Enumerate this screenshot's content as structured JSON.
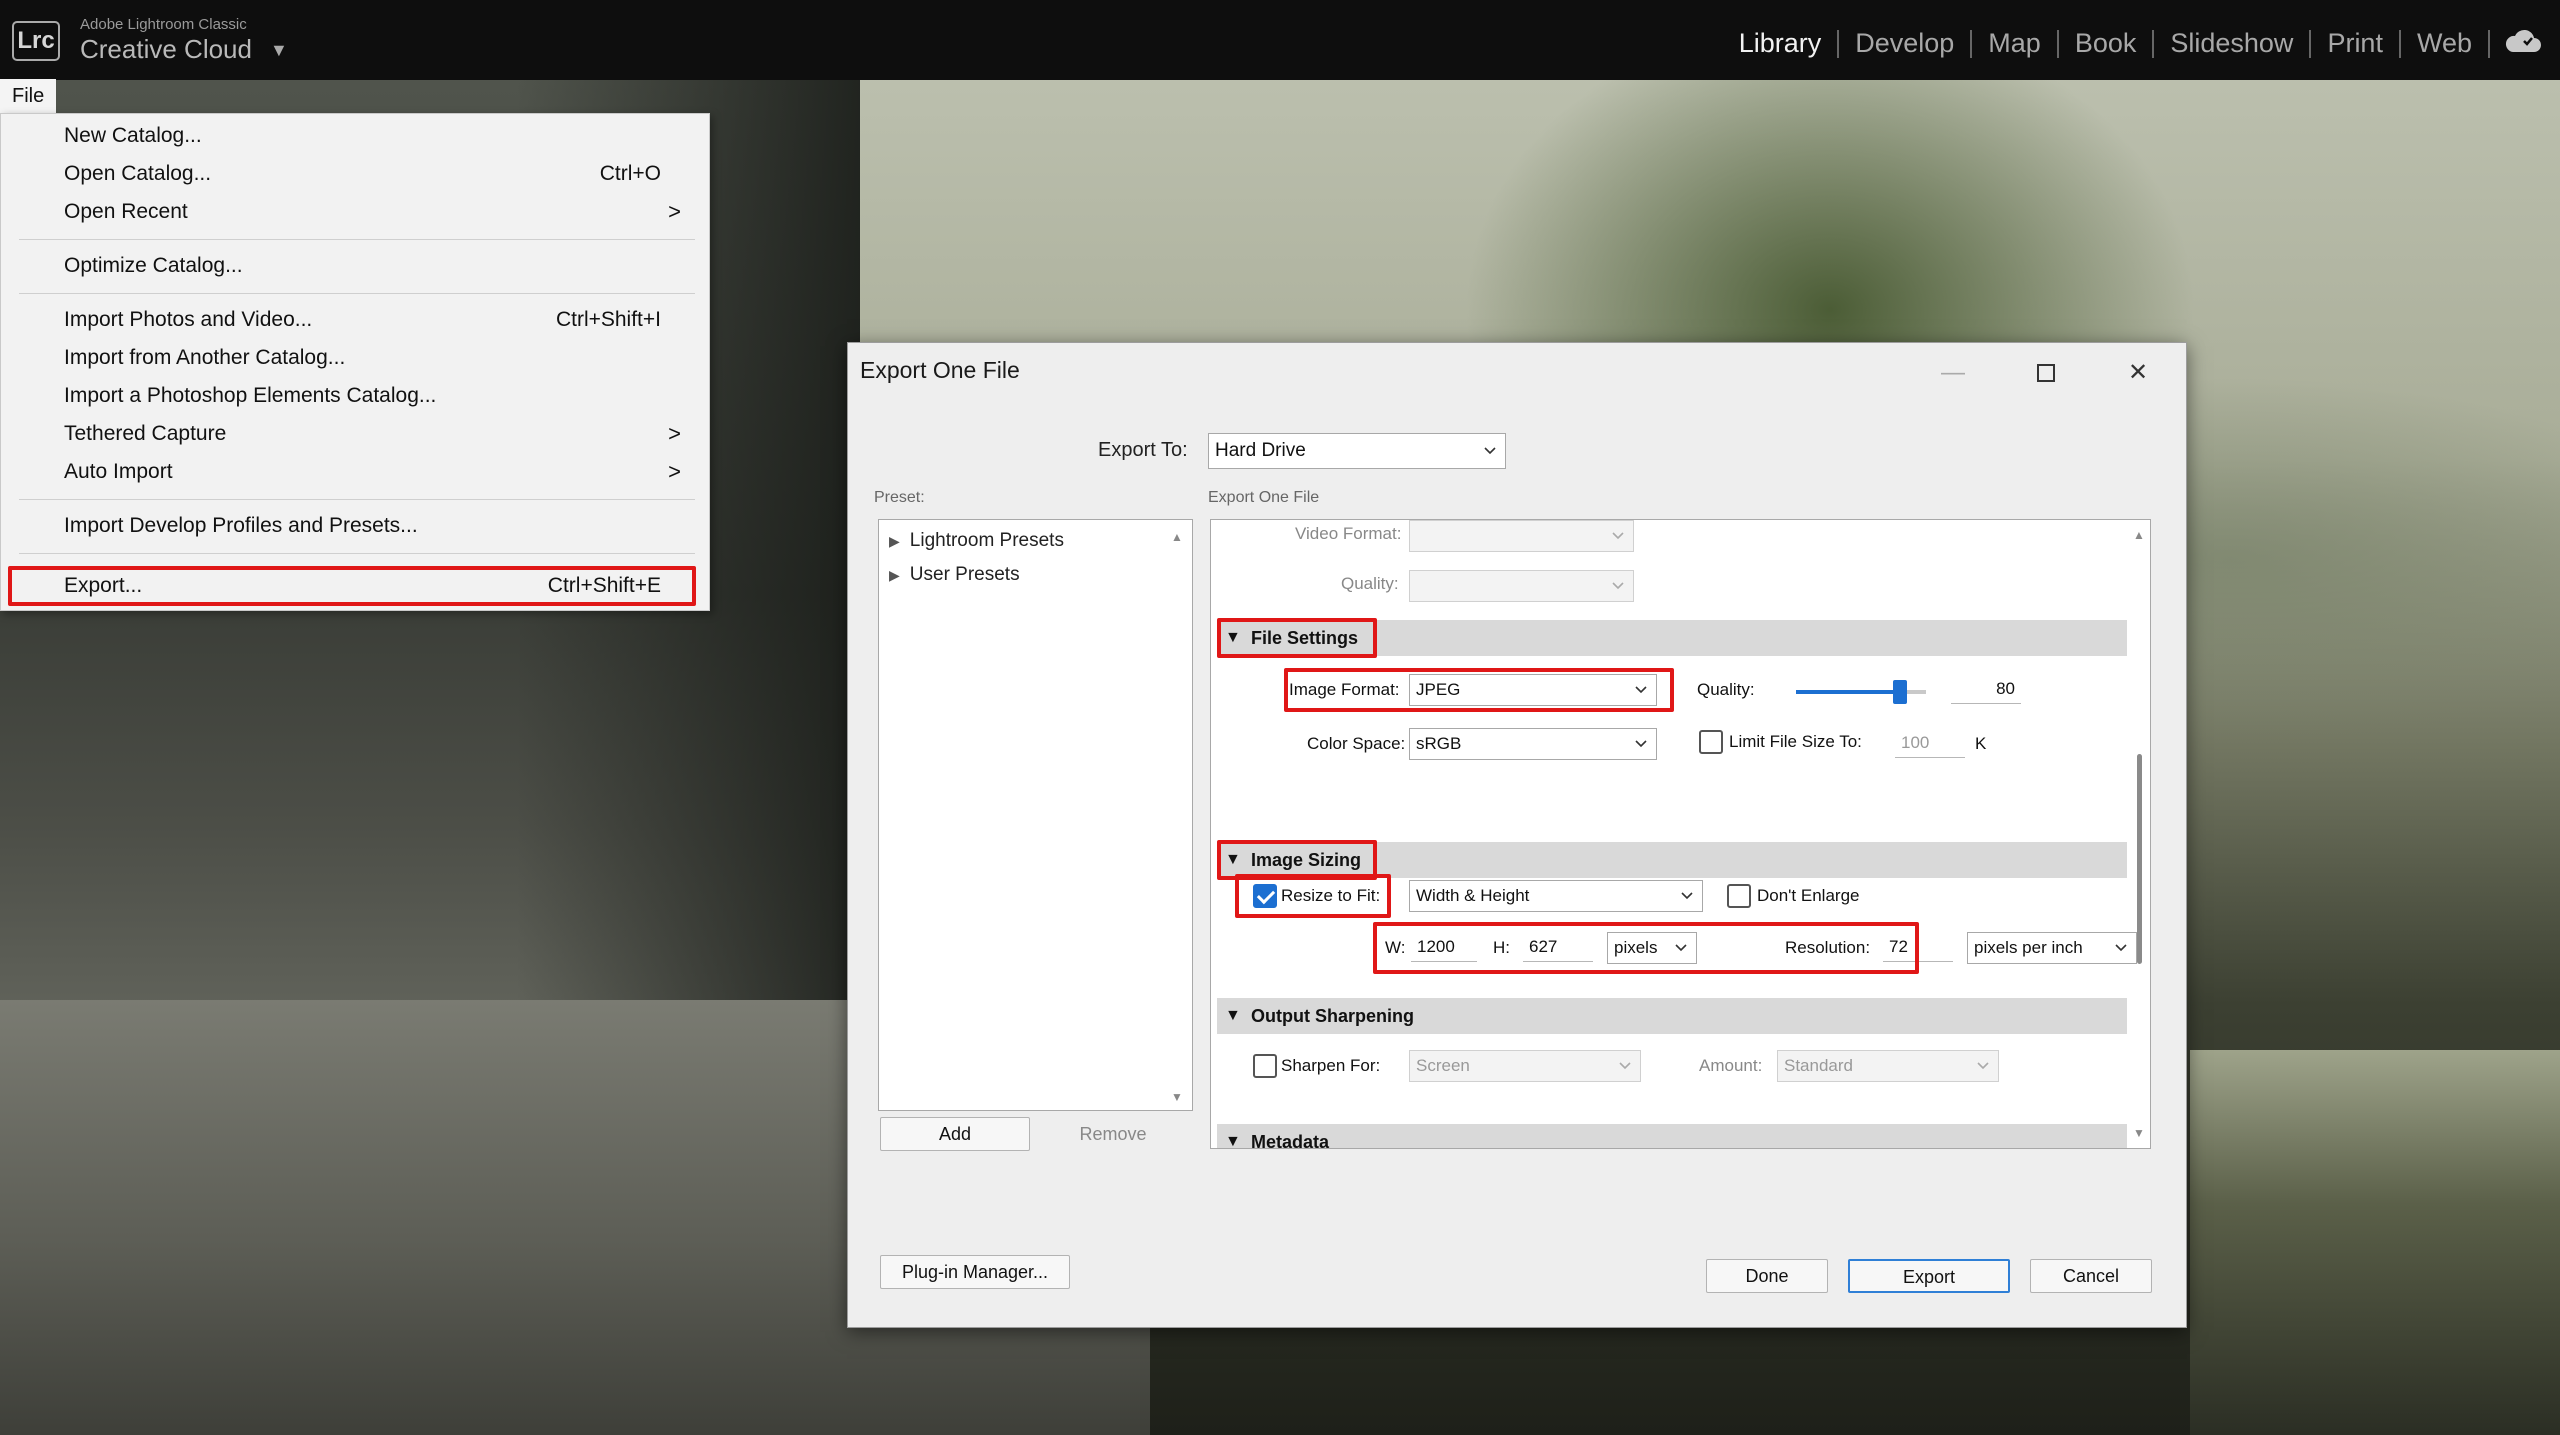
{
  "app": {
    "logo": "Lrc",
    "brand_small": "Adobe Lightroom Classic",
    "brand_big": "Creative Cloud",
    "modules": [
      "Library",
      "Develop",
      "Map",
      "Book",
      "Slideshow",
      "Print",
      "Web"
    ],
    "active_module": "Library",
    "cloud_icon": "cloud-sync-icon"
  },
  "menu": {
    "file_tab": "File",
    "items": [
      {
        "label": "New Catalog...",
        "shortcut": ""
      },
      {
        "label": "Open Catalog...",
        "shortcut": "Ctrl+O"
      },
      {
        "label": "Open Recent",
        "shortcut": ">"
      },
      {
        "label": "Optimize Catalog...",
        "shortcut": ""
      },
      {
        "label": "Import Photos and Video...",
        "shortcut": "Ctrl+Shift+I"
      },
      {
        "label": "Import from Another Catalog...",
        "shortcut": ""
      },
      {
        "label": "Import a Photoshop Elements Catalog...",
        "shortcut": ""
      },
      {
        "label": "Tethered Capture",
        "shortcut": ">"
      },
      {
        "label": "Auto Import",
        "shortcut": ">"
      },
      {
        "label": "Import Develop Profiles and Presets...",
        "shortcut": ""
      },
      {
        "label": "Export...",
        "shortcut": "Ctrl+Shift+E"
      }
    ]
  },
  "dialog": {
    "title": "Export One File",
    "export_to_label": "Export To:",
    "export_to_value": "Hard Drive",
    "preset_label": "Preset:",
    "settings_label": "Export One File",
    "presets": [
      "Lightroom Presets",
      "User Presets"
    ],
    "add_button": "Add",
    "remove_button": "Remove",
    "plugin_button": "Plug-in Manager...",
    "done_button": "Done",
    "export_button": "Export",
    "cancel_button": "Cancel",
    "video": {
      "format_label": "Video Format:",
      "quality_label": "Quality:"
    },
    "file_settings": {
      "title": "File Settings",
      "image_format_label": "Image Format:",
      "image_format_value": "JPEG",
      "quality_label": "Quality:",
      "quality_value": "80",
      "quality_fraction": 0.8,
      "color_space_label": "Color Space:",
      "color_space_value": "sRGB",
      "limit_label": "Limit File Size To:",
      "limit_value": "100",
      "limit_unit": "K"
    },
    "image_sizing": {
      "title": "Image Sizing",
      "resize_label": "Resize to Fit:",
      "resize_mode": "Width & Height",
      "dont_enlarge_label": "Don't Enlarge",
      "w_label": "W:",
      "w_value": "1200",
      "h_label": "H:",
      "h_value": "627",
      "unit_value": "pixels",
      "resolution_label": "Resolution:",
      "resolution_value": "72",
      "resolution_unit": "pixels per inch"
    },
    "output_sharpening": {
      "title": "Output Sharpening",
      "sharpen_label": "Sharpen For:",
      "sharpen_value": "Screen",
      "amount_label": "Amount:",
      "amount_value": "Standard"
    },
    "metadata": {
      "title": "Metadata"
    }
  },
  "colors": {
    "highlight": "#e01717",
    "accent": "#1c6fd1"
  }
}
